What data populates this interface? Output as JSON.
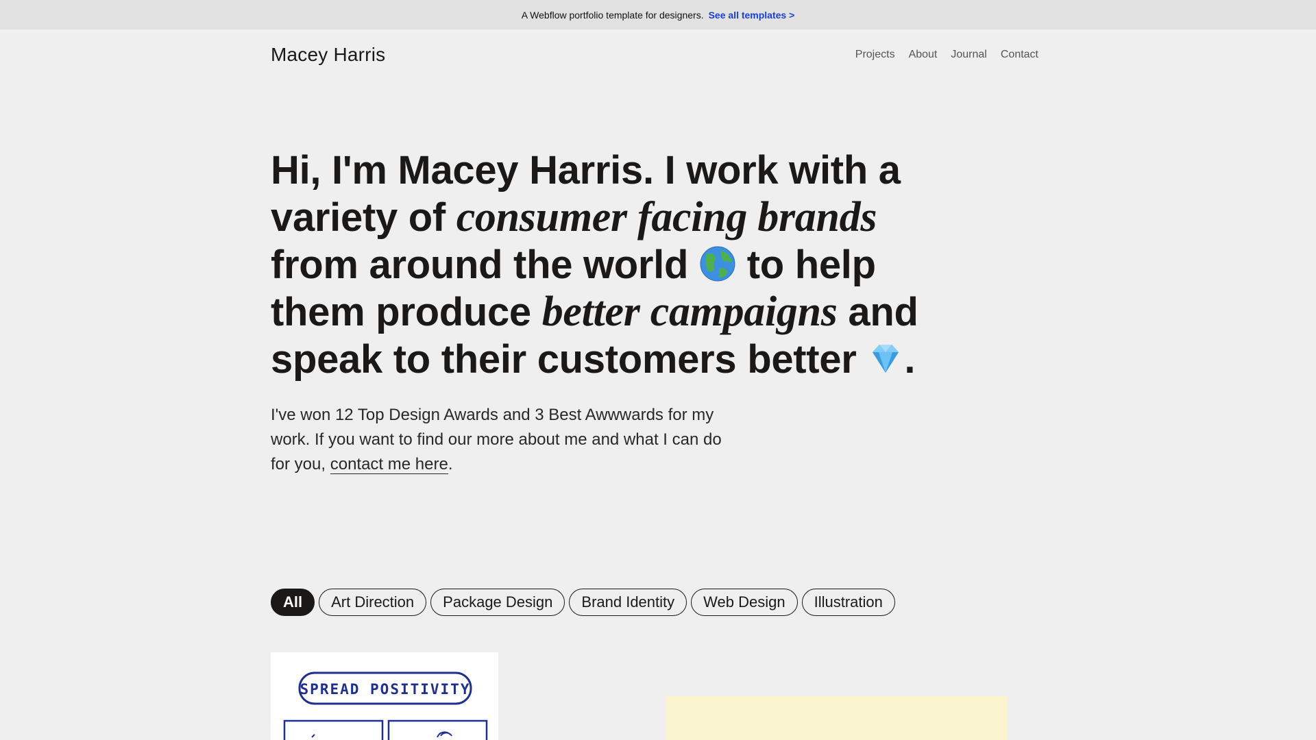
{
  "banner": {
    "text": "A Webflow portfolio template for designers.",
    "link": "See all templates >"
  },
  "header": {
    "logo": "Macey Harris",
    "nav": [
      "Projects",
      "About",
      "Journal",
      "Contact"
    ]
  },
  "hero": {
    "p1": "Hi, ",
    "b1": "I'm Macey Harris",
    "p2": ". I work with a variety of ",
    "s1": "consumer facing brands",
    "p3": " from around the world ",
    "p4": " to help them produce ",
    "s2": "better campaigns",
    "p5": " and ",
    "b2": "speak to their customers",
    "p6": " better ",
    "p7": "."
  },
  "intro": {
    "text": "I've won 12 Top Design Awards and 3 Best Awwwards for my work. If you want to find our more about me and what I can do for you, ",
    "link": "contact me here",
    "end": "."
  },
  "filters": [
    "All",
    "Art Direction",
    "Package Design",
    "Brand Identity",
    "Web Design",
    "Illustration"
  ],
  "projects": {
    "positivity_title": "SPREAD POSITIVITY"
  },
  "icons": {
    "globe": "globe-icon",
    "gem": "gem-icon"
  },
  "colors": {
    "background": "#efefef",
    "text": "#1b1917",
    "link": "#1a3fd6",
    "banner": "#e1e1e1",
    "yellow_card": "#faf5cf",
    "illustration_ink": "#1f2f8f"
  }
}
